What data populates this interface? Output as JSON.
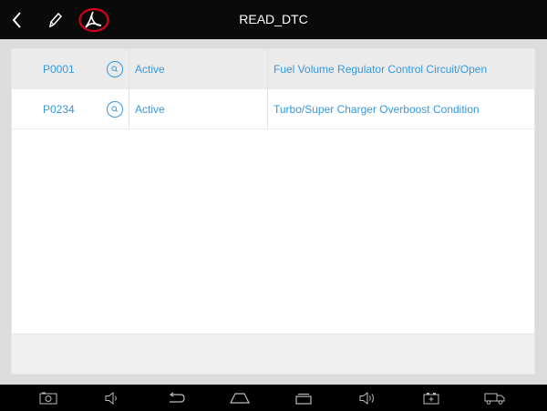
{
  "header": {
    "title": "READ_DTC",
    "icons": [
      "back-icon",
      "pen-icon",
      "pdf-icon"
    ],
    "pdf_highlight_color": "#d0021b"
  },
  "dtc_list": [
    {
      "code": "P0001",
      "status": "Active",
      "description": "Fuel Volume Regulator Control Circuit/Open",
      "selected": true
    },
    {
      "code": "P0234",
      "status": "Active",
      "description": "Turbo/Super Charger Overboost Condition",
      "selected": false
    }
  ],
  "colors": {
    "accent": "#3399e0",
    "topbar": "#0a0a0a",
    "background": "#dcdcdc"
  },
  "navbar": {
    "icons": [
      "screenshot-icon",
      "volume-down-icon",
      "back-nav-icon",
      "home-icon",
      "recents-icon",
      "volume-up-icon",
      "vci-icon",
      "truck-icon"
    ]
  }
}
